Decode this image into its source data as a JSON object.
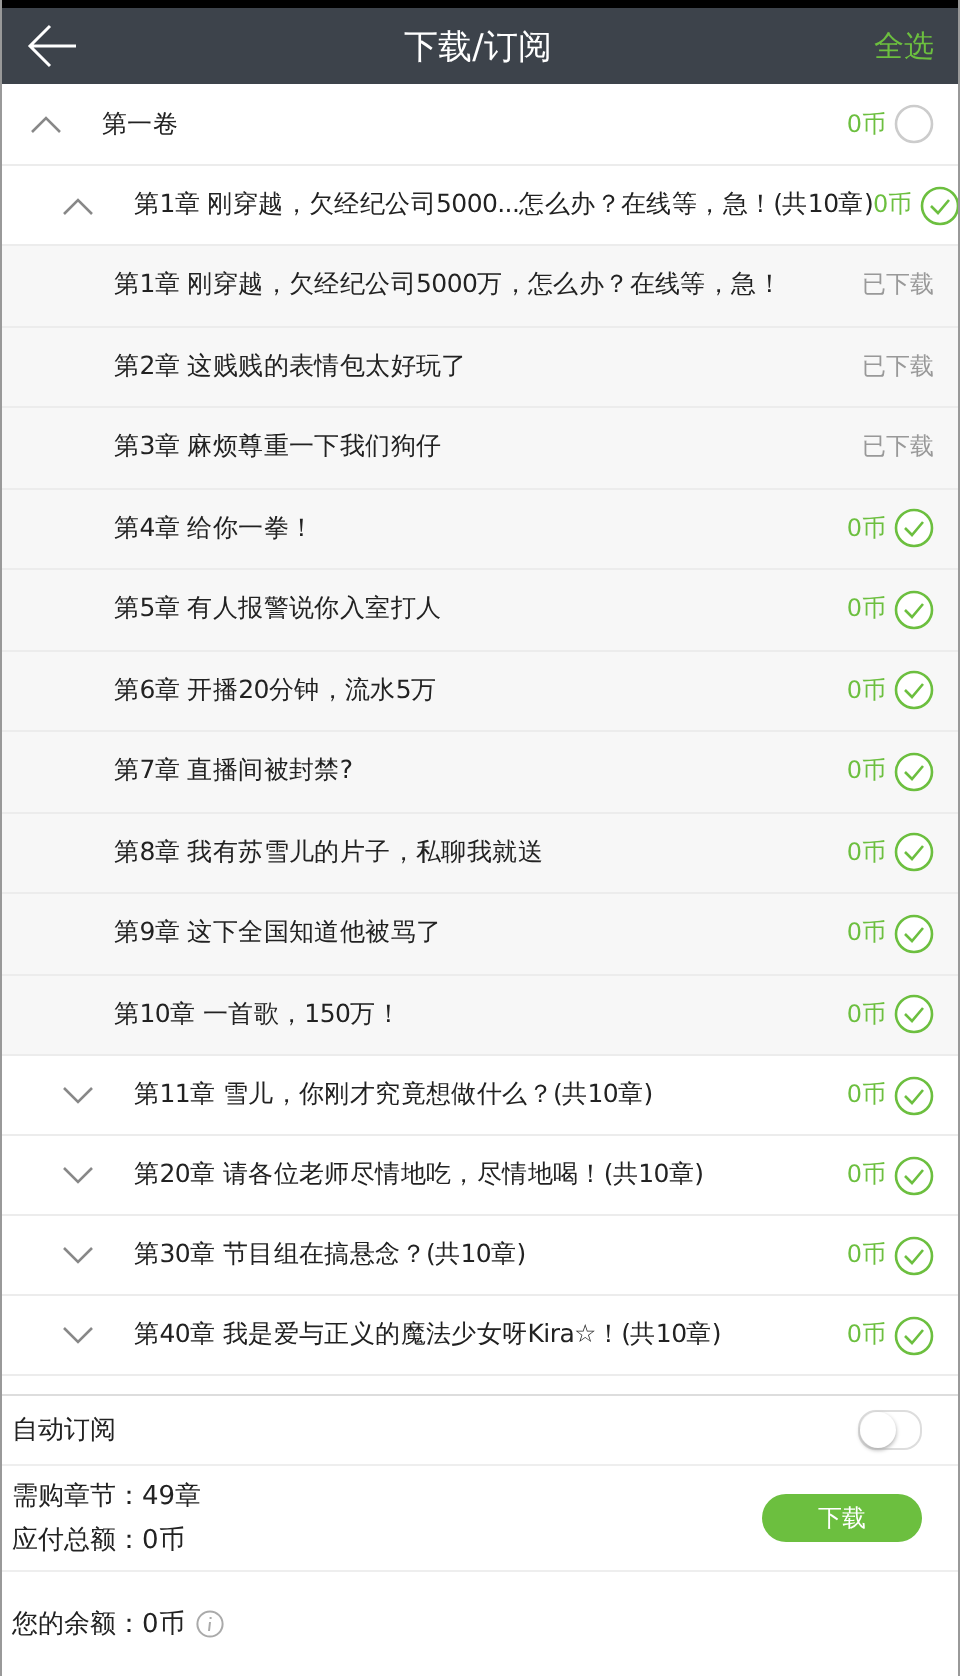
{
  "header": {
    "title": "下载/订阅",
    "select_all": "全选"
  },
  "volume": {
    "title": "第一卷",
    "price": "0币",
    "checked": false,
    "expanded": true,
    "groups": [
      {
        "title": "第1章 刚穿越，欠经纪公司5000...怎么办？在线等，急！(共10章)",
        "price": "0币",
        "checked": true,
        "expanded": true,
        "chapters": [
          {
            "title": "第1章 刚穿越，欠经纪公司5000万，怎么办？在线等，急！",
            "kind": "downloaded",
            "status": "已下载"
          },
          {
            "title": "第2章 这贱贱的表情包太好玩了",
            "kind": "downloaded",
            "status": "已下载"
          },
          {
            "title": "第3章 麻烦尊重一下我们狗仔",
            "kind": "downloaded",
            "status": "已下载"
          },
          {
            "title": "第4章 给你一拳！",
            "kind": "paid",
            "price": "0币",
            "checked": true
          },
          {
            "title": "第5章 有人报警说你入室打人",
            "kind": "paid",
            "price": "0币",
            "checked": true
          },
          {
            "title": "第6章 开播20分钟，流水5万",
            "kind": "paid",
            "price": "0币",
            "checked": true
          },
          {
            "title": "第7章 直播间被封禁?",
            "kind": "paid",
            "price": "0币",
            "checked": true
          },
          {
            "title": "第8章 我有苏雪儿的片子，私聊我就送",
            "kind": "paid",
            "price": "0币",
            "checked": true
          },
          {
            "title": "第9章 这下全国知道他被骂了",
            "kind": "paid",
            "price": "0币",
            "checked": true
          },
          {
            "title": "第10章 一首歌，150万！",
            "kind": "paid",
            "price": "0币",
            "checked": true
          }
        ]
      },
      {
        "title": "第11章 雪儿，你刚才究竟想做什么？(共10章)",
        "price": "0币",
        "checked": true,
        "expanded": false
      },
      {
        "title": "第20章 请各位老师尽情地吃，尽情地喝！(共10章)",
        "price": "0币",
        "checked": true,
        "expanded": false
      },
      {
        "title": "第30章 节目组在搞悬念？(共10章)",
        "price": "0币",
        "checked": true,
        "expanded": false
      },
      {
        "title": "第40章 我是爱与正义的魔法少女呀Kira☆！(共10章)",
        "price": "0币",
        "checked": true,
        "expanded": false
      }
    ]
  },
  "auto_subscribe": {
    "label": "自动订阅",
    "on": false
  },
  "summary": {
    "chapters": "需购章节：49章",
    "total": "应付总额：0币",
    "button": "下载"
  },
  "balance": {
    "text": "您的余额：0币"
  }
}
